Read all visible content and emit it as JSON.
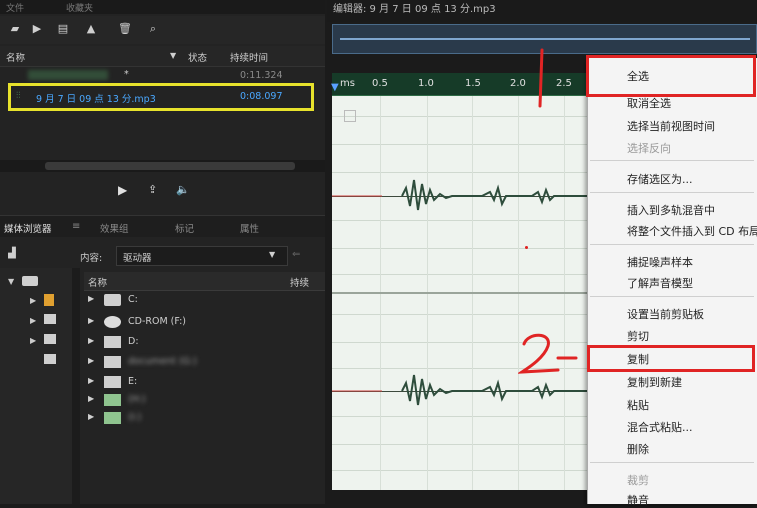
{
  "top_menu": {
    "item1": "文件",
    "item2": "收藏夹"
  },
  "file_panel": {
    "columns": {
      "name": "名称",
      "status": "状态",
      "duration": "持续时间"
    },
    "rows": [
      {
        "name": "",
        "status": "*",
        "duration": "0:11.324"
      },
      {
        "name": "9 月 7 日 09 点 13 分.mp3",
        "status": "",
        "duration": "0:08.097"
      }
    ]
  },
  "media_panel": {
    "tabs": [
      "媒体浏览器",
      "效果组",
      "标记",
      "属性"
    ],
    "content_label": "内容:",
    "content_value": "驱动器",
    "list_header": {
      "name": "名称",
      "duration": "持续"
    },
    "drives": [
      {
        "name": "C:"
      },
      {
        "name": "CD-ROM (F:)"
      },
      {
        "name": "D:"
      },
      {
        "name": "document (G:)"
      },
      {
        "name": "E:"
      },
      {
        "name": "(H:)"
      },
      {
        "name": "(I:)"
      }
    ]
  },
  "editor": {
    "title": "编辑器: 9 月 7 日 09 点 13 分.mp3",
    "ruler_ticks": [
      "ms",
      "0.5",
      "1.0",
      "1.5",
      "2.0",
      "2.5"
    ]
  },
  "context_menu": {
    "items": [
      {
        "label": "全选",
        "enabled": true
      },
      {
        "label": "取消全选",
        "enabled": true
      },
      {
        "label": "选择当前视图时间",
        "enabled": true
      },
      {
        "label": "选择反向",
        "enabled": false
      },
      {
        "label": "存储选区为...",
        "enabled": true
      },
      {
        "label": "插入到多轨混音中",
        "enabled": true
      },
      {
        "label": "将整个文件插入到 CD 布局",
        "enabled": true
      },
      {
        "label": "捕捉噪声样本",
        "enabled": true
      },
      {
        "label": "了解声音模型",
        "enabled": true
      },
      {
        "label": "设置当前剪贴板",
        "enabled": true
      },
      {
        "label": "剪切",
        "enabled": true
      },
      {
        "label": "复制",
        "enabled": true
      },
      {
        "label": "复制到新建",
        "enabled": true
      },
      {
        "label": "粘贴",
        "enabled": true
      },
      {
        "label": "混合式粘贴...",
        "enabled": true
      },
      {
        "label": "删除",
        "enabled": true
      },
      {
        "label": "裁剪",
        "enabled": false
      },
      {
        "label": "静音",
        "enabled": true
      }
    ]
  },
  "annotations": {
    "step1": "1",
    "step2": "2"
  },
  "colors": {
    "highlight_yellow": "#e7e22c",
    "annotation_red": "#e02424",
    "waveform": "#2e4d3c",
    "ruler_green": "#163b28"
  }
}
